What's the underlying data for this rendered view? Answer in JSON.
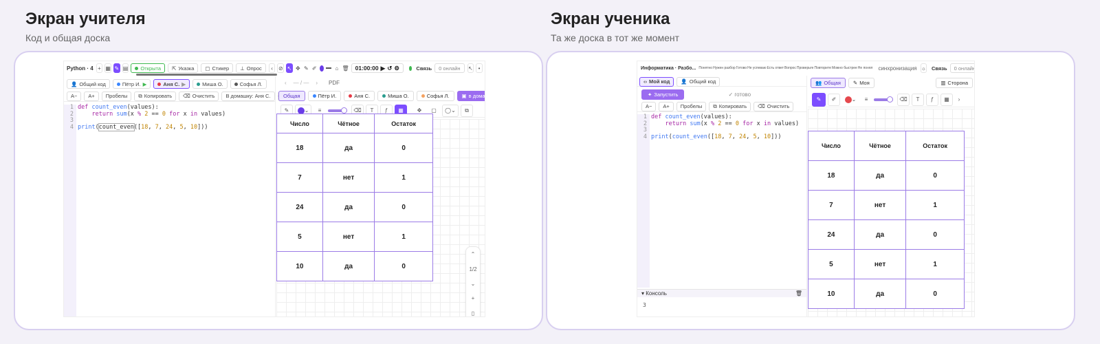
{
  "teacher": {
    "title": "Экран учителя",
    "subtitle": "Код и общая доска",
    "app_title": "Python · 4",
    "tb": {
      "open": "Открыта",
      "pointer": "Указка",
      "sticker": "Стикер",
      "poll": "Опрос",
      "timer": "01:00:00",
      "link": "Связь",
      "online": "0 онлайн"
    },
    "students": [
      {
        "label": "Общий код",
        "color": ""
      },
      {
        "label": "Пётр И.",
        "color": "#3a86ff"
      },
      {
        "label": "Аня С.",
        "color": "#e63946"
      },
      {
        "label": "Миша О.",
        "color": "#2a9d8f"
      },
      {
        "label": "Софья Л.",
        "color": "#555555"
      }
    ],
    "ctrl": {
      "a_minus": "A−",
      "a_plus": "A+",
      "spaces": "Пробелы",
      "copy": "Копировать",
      "clear": "Очистить",
      "homework": "В домашку: Аня С."
    },
    "board": {
      "page_label": "— / —",
      "pdf": "PDF",
      "tabs": [
        {
          "label": "Общая",
          "color": ""
        },
        {
          "label": "Пётр И.",
          "color": "#3a86ff"
        },
        {
          "label": "Аня С.",
          "color": "#e63946"
        },
        {
          "label": "Миша О.",
          "color": "#2a9d8f"
        },
        {
          "label": "Софья Л.",
          "color": "#f4a261"
        },
        {
          "label": "в домашку",
          "color": ""
        }
      ],
      "page_counter": "1/2"
    }
  },
  "student": {
    "title": "Экран ученика",
    "subtitle": "Та же доска в тот же момент",
    "app_title": "Информатика · Разбо...",
    "tb": {
      "chips": [
        "Понятно",
        "Нужен разбор",
        "Готово",
        "Не успеваю",
        "Есть ответ",
        "Вопрос",
        "Проверьте",
        "Повторите",
        "Можно быстрее",
        "Не понял"
      ],
      "sync": "синхронизация",
      "link": "Связь",
      "online": "0 онлайн"
    },
    "left_tabs": {
      "mine": "Мой код",
      "shared": "Общий код"
    },
    "run": "Запустить",
    "status": "✓ готово",
    "ctrl": {
      "a_minus": "A−",
      "a_plus": "A+",
      "spaces": "Пробелы",
      "copy": "Копировать",
      "clear": "Очистить"
    },
    "board_tabs": {
      "shared": "Общая",
      "mine": "Моя",
      "side": "Сторона"
    },
    "console": {
      "label": "Консоль",
      "output": "3"
    }
  },
  "code": {
    "lines": [
      "1",
      "2",
      "3",
      "4"
    ]
  },
  "table": {
    "headers": [
      "Число",
      "Чётное",
      "Остаток"
    ],
    "rows": [
      [
        "18",
        "да",
        "0"
      ],
      [
        "7",
        "нет",
        "1"
      ],
      [
        "24",
        "да",
        "0"
      ],
      [
        "5",
        "нет",
        "1"
      ],
      [
        "10",
        "да",
        "0"
      ]
    ]
  },
  "colors": {
    "accent": "#7c4dff",
    "pen": "#6a3de8",
    "red": "#e5484d",
    "green": "#3fb950"
  }
}
